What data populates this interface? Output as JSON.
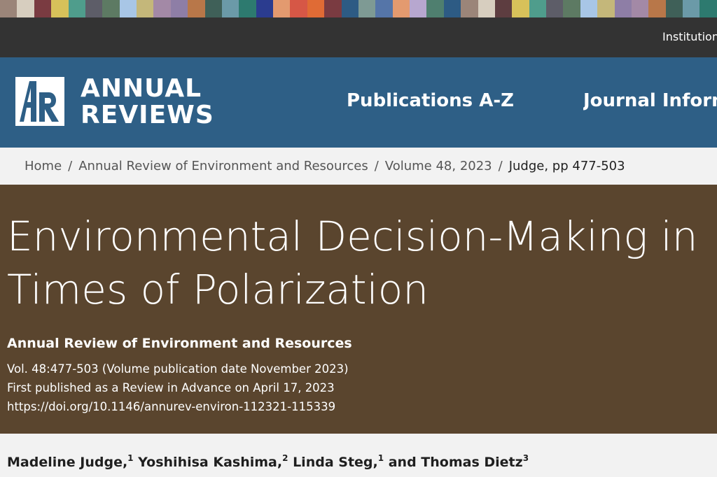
{
  "palette": [
    "#9b8579",
    "#d7cebf",
    "#7a3b41",
    "#d7c15a",
    "#4f9d8c",
    "#5d5d68",
    "#5d7a63",
    "#a8c6e6",
    "#c4b77a",
    "#a389a6",
    "#8e7ea6",
    "#b87749",
    "#3f6058",
    "#6b9aa8",
    "#2d7a6f",
    "#2b3c8f",
    "#e39a6f",
    "#d65746",
    "#e06b35",
    "#7a3b41",
    "#2d5b84",
    "#7e9a94",
    "#5575a8",
    "#e39a6f",
    "#b7a7cf",
    "#4f7f6f",
    "#2d5b84",
    "#9b8579",
    "#d7cebf",
    "#5d3d40",
    "#d7c15a",
    "#4f9d8c",
    "#5d5d68",
    "#5d7a63",
    "#a8c6e6",
    "#c4b77a",
    "#8e7ea6",
    "#a389a6",
    "#b87749",
    "#3f6058",
    "#6b9aa8",
    "#2d7a6f",
    "#2b3c8f"
  ],
  "topbar": {
    "institution_text": "Institutional"
  },
  "header": {
    "logo_line1": "ANNUAL",
    "logo_line2": "REVIEWS",
    "nav": {
      "publications": "Publications A-Z",
      "journal": "Journal Information"
    }
  },
  "breadcrumb": {
    "home": "Home",
    "journal": "Annual Review of Environment and Resources",
    "volume": "Volume 48, 2023",
    "current": "Judge, pp 477-503",
    "separator": "/"
  },
  "article": {
    "title_line1": "Environmental Decision-Making in",
    "title_line2": "Times of Polarization",
    "journal": "Annual Review of Environment and Resources",
    "volume_info": "Vol. 48:477-503 (Volume publication date November 2023)",
    "advance_info": "First published as a Review in Advance on April 17, 2023",
    "doi": "https://doi.org/10.1146/annurev-environ-112321-115339"
  },
  "authors": [
    {
      "name": "Madeline Judge,",
      "aff": "1"
    },
    {
      "name": "Yoshihisa Kashima,",
      "aff": "2"
    },
    {
      "name": "Linda Steg,",
      "aff": "1"
    },
    {
      "name": "and Thomas Dietz",
      "aff": "3"
    }
  ]
}
